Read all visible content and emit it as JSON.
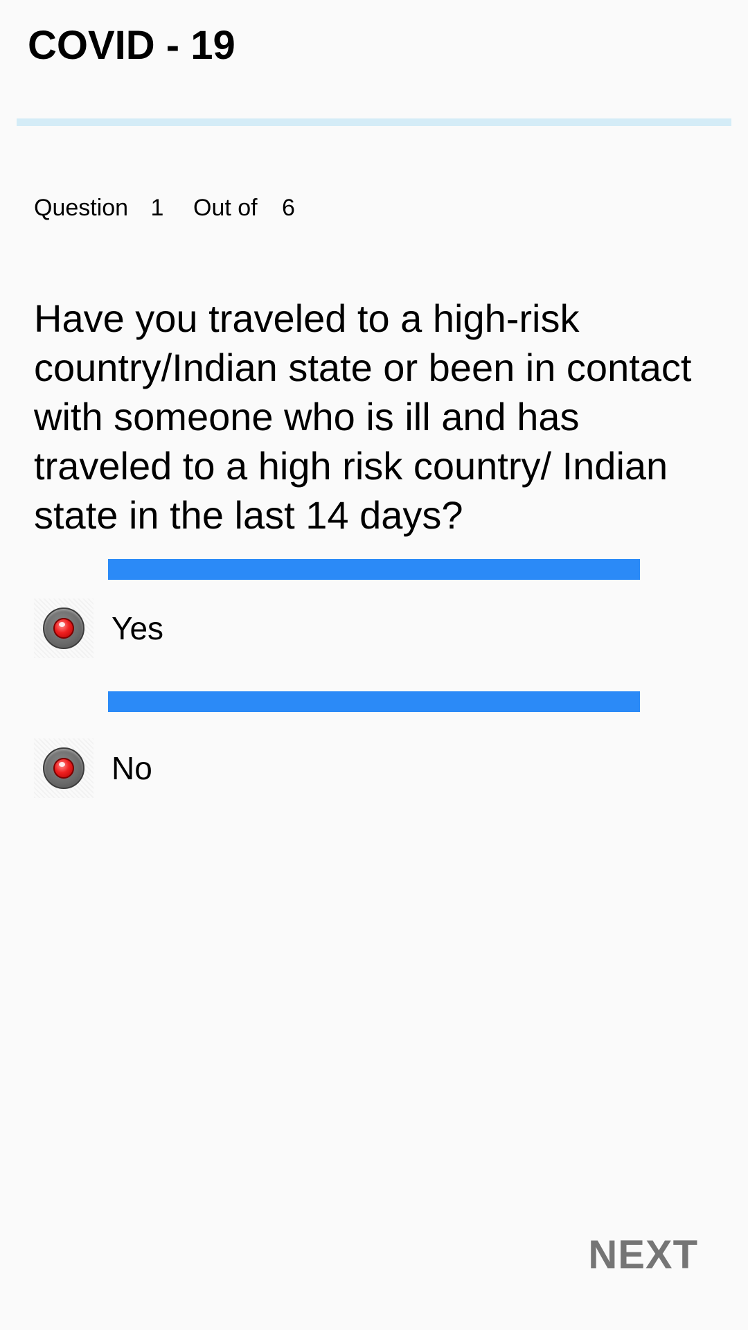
{
  "header": {
    "title": "COVID - 19"
  },
  "counter": {
    "question_label": "Question",
    "current": "1",
    "out_of_label": "Out of",
    "total": "6"
  },
  "question": {
    "text": "Have you traveled to a high-risk country/Indian state or been in contact with someone who is ill and has traveled to a high risk country/ Indian state in the last 14 days?"
  },
  "options": [
    {
      "label": "Yes",
      "icon": "radio-button-icon"
    },
    {
      "label": "No",
      "icon": "radio-button-icon"
    }
  ],
  "footer": {
    "next_label": "NEXT"
  },
  "colors": {
    "background": "#fafafa",
    "divider": "#d4ecf7",
    "option_bar": "#2b8af7",
    "next_text": "#757575",
    "radio_dot": "#ef2020"
  }
}
